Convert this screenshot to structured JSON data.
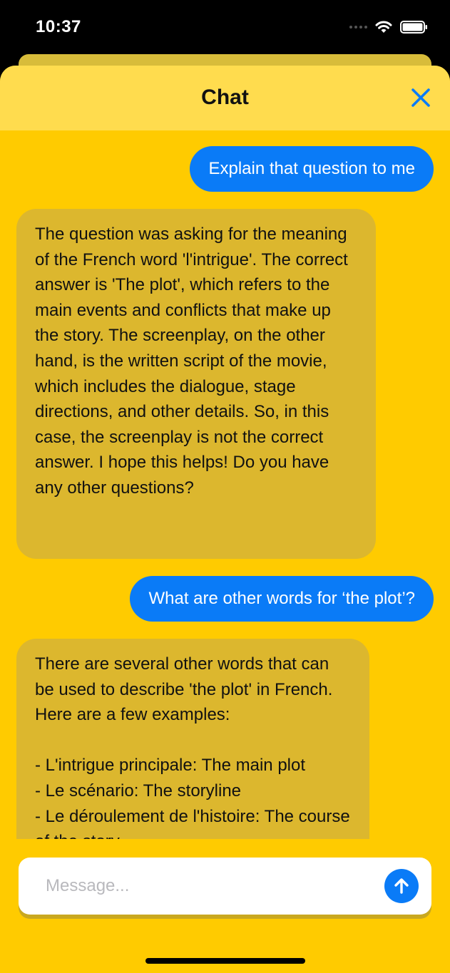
{
  "status_bar": {
    "time": "10:37"
  },
  "header": {
    "title": "Chat"
  },
  "messages": [
    {
      "role": "user",
      "text": "Explain that question to me"
    },
    {
      "role": "assistant",
      "text": "The question was asking for the meaning of the French word 'l'intrigue'. The correct answer is 'The plot', which refers to the main events and conflicts that make up the story. The screenplay, on the other hand, is the written script of the movie, which includes the dialogue, stage directions, and other details. So, in this case, the screenplay is not the correct answer. I hope this helps! Do you have any other questions?"
    },
    {
      "role": "user",
      "text": "What are other words for ‘the plot’?"
    },
    {
      "role": "assistant",
      "text": "There are several other words that can be used to describe 'the plot' in French. Here are a few examples:\n\n- L'intrigue principale: The main plot\n- Le scénario: The storyline\n- Le déroulement de l'histoire: The course of the story"
    }
  ],
  "composer": {
    "placeholder": "Message...",
    "value": ""
  },
  "icons": {
    "close": "close-icon",
    "send": "arrow-up-icon",
    "wifi": "wifi-icon",
    "battery": "battery-icon"
  },
  "colors": {
    "sheet_background": "#ffcb00",
    "header_background": "#ffdc4e",
    "user_bubble": "#0a7bf7",
    "assistant_bubble": "#dcb72e",
    "accent": "#0a7bf7"
  }
}
